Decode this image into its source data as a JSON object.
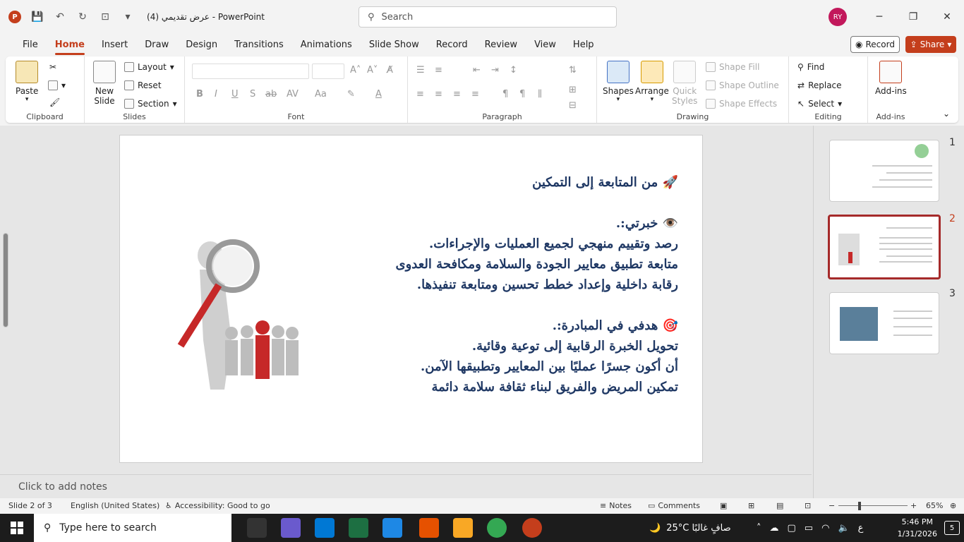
{
  "titlebar": {
    "doc_title": "عرض تقديمي (4)  -  PowerPoint",
    "search_placeholder": "Search",
    "user_initials": "RY"
  },
  "menu": [
    "File",
    "Home",
    "Insert",
    "Draw",
    "Design",
    "Transitions",
    "Animations",
    "Slide Show",
    "Record",
    "Review",
    "View",
    "Help"
  ],
  "menu_active": "Home",
  "record_label": "Record",
  "share_label": "Share",
  "ribbon": {
    "clipboard": {
      "paste": "Paste",
      "label": "Clipboard"
    },
    "slides": {
      "new_slide_1": "New",
      "new_slide_2": "Slide",
      "layout": "Layout",
      "reset": "Reset",
      "section": "Section",
      "label": "Slides"
    },
    "font": {
      "label": "Font"
    },
    "paragraph": {
      "label": "Paragraph"
    },
    "drawing": {
      "shapes": "Shapes",
      "arrange": "Arrange",
      "quick_1": "Quick",
      "quick_2": "Styles",
      "shape_fill": "Shape Fill",
      "shape_outline": "Shape Outline",
      "shape_effects": "Shape Effects",
      "label": "Drawing"
    },
    "editing": {
      "find": "Find",
      "replace": "Replace",
      "select": "Select",
      "label": "Editing"
    },
    "addins": {
      "btn": "Add-ins",
      "label": "Add-ins"
    }
  },
  "slide": {
    "lines": [
      "🚀 من المتابعة إلى التمكين",
      "",
      "👁️ خبرتي:.",
      "رصد وتقييم منهجي لجميع العمليات والإجراءات.",
      "متابعة تطبيق معايير الجودة والسلامة ومكافحة العدوى",
      "رقابة داخلية وإعداد خطط تحسين ومتابعة تنفيذها.",
      "",
      "🎯 هدفي في المبادرة:.",
      "تحويل الخبرة الرقابية إلى توعية وقائية.",
      "أن أكون جسرًا عمليًا بين المعايير وتطبيقها الآمن.",
      "تمكين المريض والفريق لبناء ثقافة سلامة دائمة"
    ]
  },
  "notes_placeholder": "Click to add notes",
  "thumbnails": [
    "1",
    "2",
    "3"
  ],
  "active_slide": 2,
  "status": {
    "slide_pos": "Slide 2 of 3",
    "language": "English (United States)",
    "accessibility": "Accessibility: Good to go",
    "notes": "Notes",
    "comments": "Comments",
    "zoom": "65%"
  },
  "taskbar": {
    "search_placeholder": "Type here to search",
    "weather": "25°C  صافٍ غالبًا",
    "lang": "ع",
    "time": "5:46 PM",
    "date": "1/31/2026",
    "notif_count": "5"
  }
}
